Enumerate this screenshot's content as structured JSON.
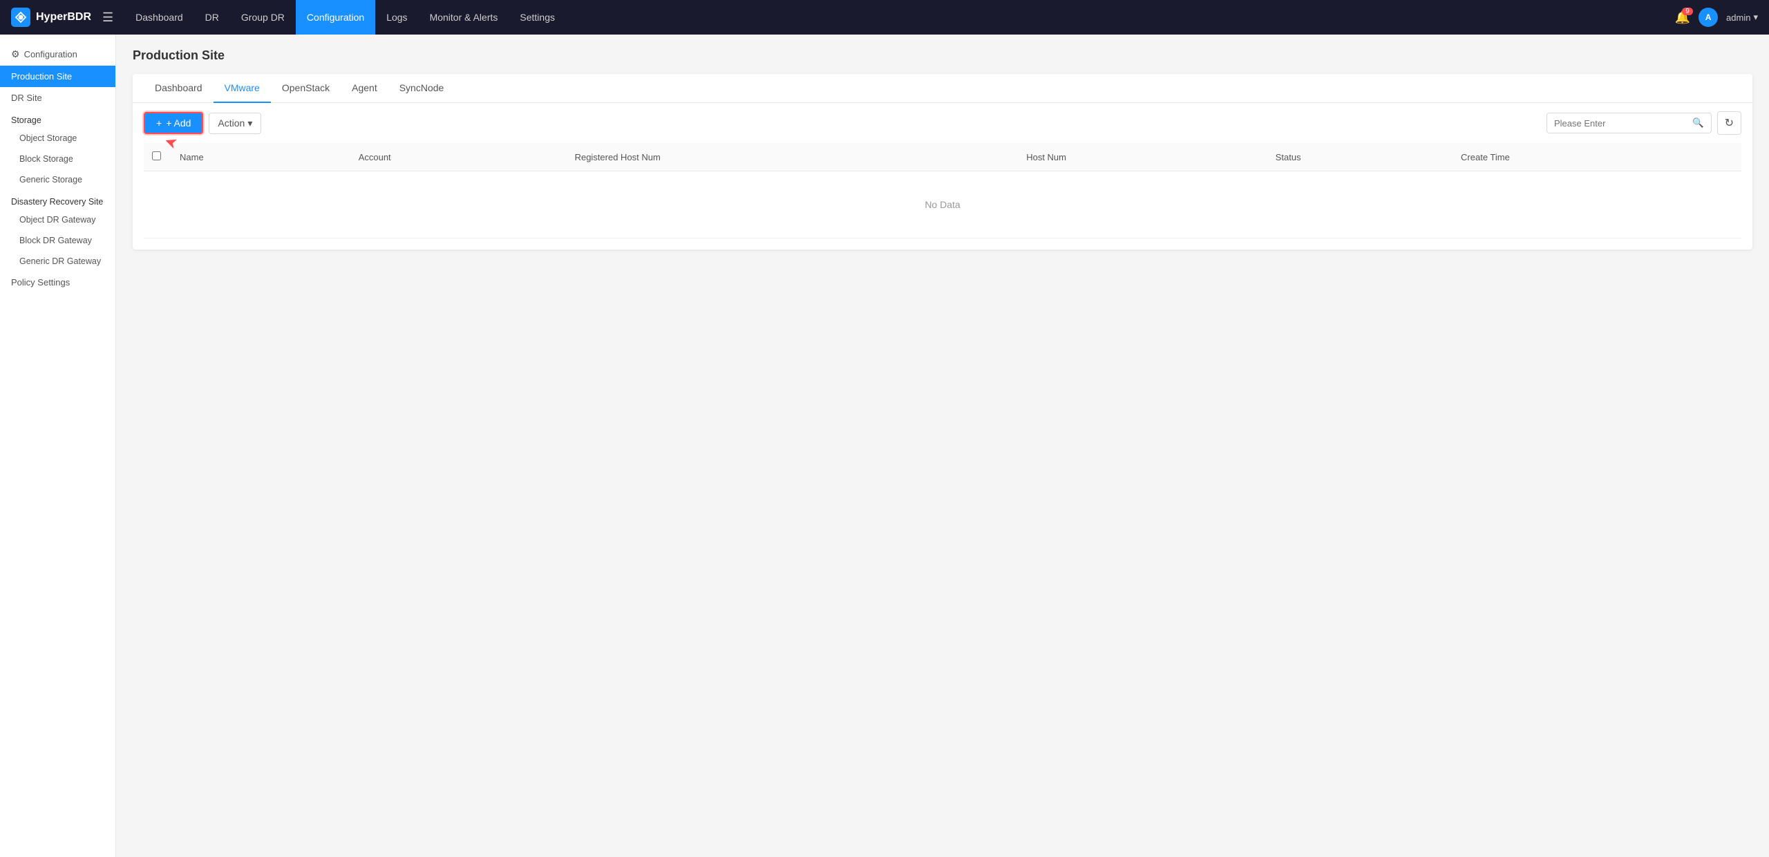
{
  "app": {
    "name": "HyperBDR",
    "logo_alt": "HyperBDR Logo"
  },
  "topnav": {
    "links": [
      {
        "label": "Dashboard",
        "active": false
      },
      {
        "label": "DR",
        "active": false
      },
      {
        "label": "Group DR",
        "active": false
      },
      {
        "label": "Configuration",
        "active": true
      },
      {
        "label": "Logs",
        "active": false
      },
      {
        "label": "Monitor & Alerts",
        "active": false
      },
      {
        "label": "Settings",
        "active": false
      }
    ],
    "bell_badge": "9",
    "user_label": "admin"
  },
  "sidebar": {
    "section_label": "Configuration",
    "items": [
      {
        "label": "Production Site",
        "active": true,
        "sub": false
      },
      {
        "label": "DR Site",
        "active": false,
        "sub": false
      },
      {
        "label": "Storage",
        "active": false,
        "sub": false,
        "is_group": true
      },
      {
        "label": "Object Storage",
        "active": false,
        "sub": true
      },
      {
        "label": "Block Storage",
        "active": false,
        "sub": true
      },
      {
        "label": "Generic Storage",
        "active": false,
        "sub": true
      },
      {
        "label": "Disastery Recovery Site",
        "active": false,
        "sub": false,
        "is_group": true
      },
      {
        "label": "Object DR Gateway",
        "active": false,
        "sub": true
      },
      {
        "label": "Block DR Gateway",
        "active": false,
        "sub": true
      },
      {
        "label": "Generic DR Gateway",
        "active": false,
        "sub": true
      },
      {
        "label": "Policy Settings",
        "active": false,
        "sub": false
      }
    ]
  },
  "page": {
    "title": "Production Site"
  },
  "tabs": [
    {
      "label": "Dashboard",
      "active": false
    },
    {
      "label": "VMware",
      "active": true
    },
    {
      "label": "OpenStack",
      "active": false
    },
    {
      "label": "Agent",
      "active": false
    },
    {
      "label": "SyncNode",
      "active": false
    }
  ],
  "toolbar": {
    "add_label": "+ Add",
    "action_label": "Action",
    "search_placeholder": "Please Enter"
  },
  "table": {
    "columns": [
      "Name",
      "Account",
      "Registered Host Num",
      "Host Num",
      "Status",
      "Create Time"
    ],
    "rows": [],
    "no_data_label": "No Data"
  }
}
